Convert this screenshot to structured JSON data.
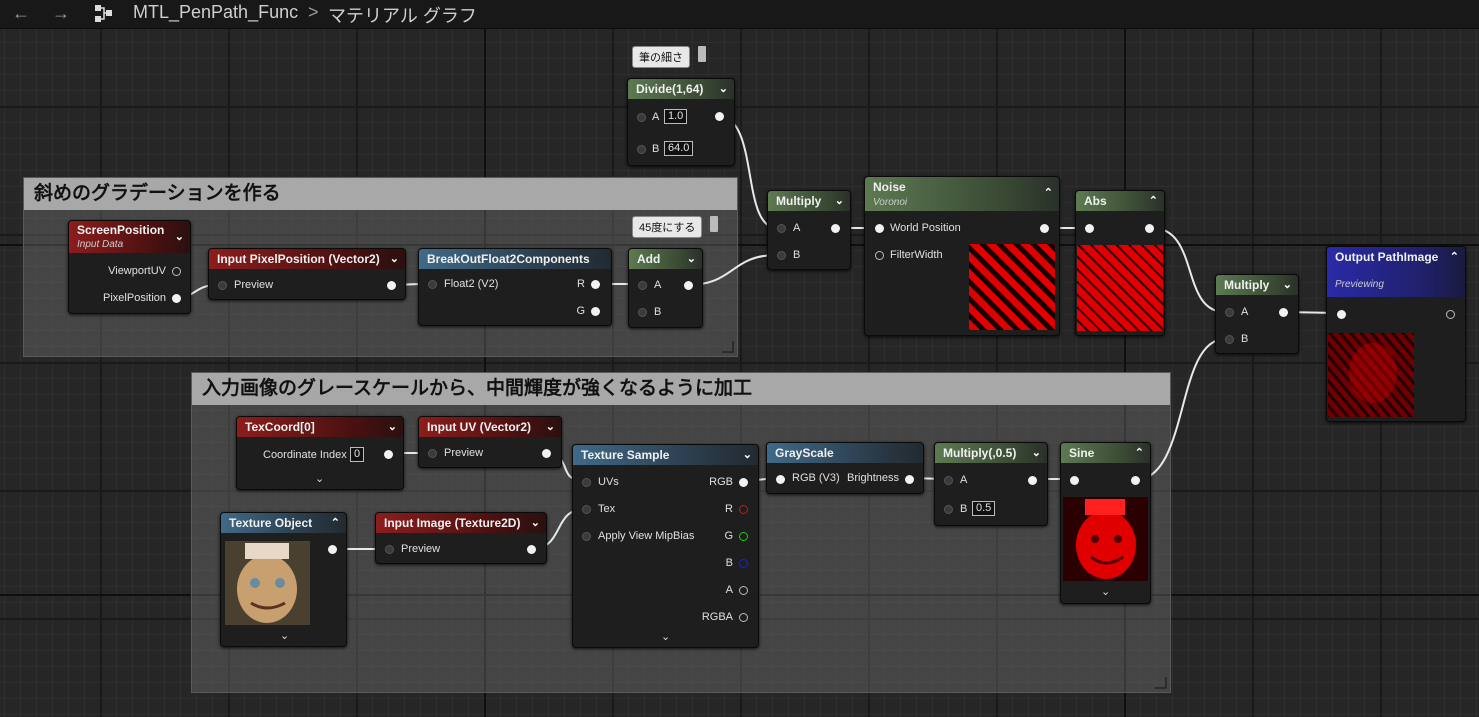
{
  "breadcrumb": {
    "back_icon": "arrow-left-icon",
    "forward_icon": "arrow-right-icon",
    "graph_icon": "node-graph-icon",
    "asset": "MTL_PenPath_Func",
    "separator": ">",
    "graph": "マテリアル グラフ"
  },
  "comments": {
    "gradient": "斜めのグラデーションを作る",
    "gray": "入力画像のグレースケールから、中間輝度が強くなるように加工"
  },
  "tags": {
    "pen_width": "筆の細さ",
    "rotate45": "45度にする"
  },
  "nodes": {
    "screen_position": {
      "title": "ScreenPosition",
      "subtitle": "Input Data",
      "out1": "ViewportUV",
      "out2": "PixelPosition"
    },
    "input_pixel": {
      "title": "Input PixelPosition (Vector2)",
      "pin": "Preview"
    },
    "breakout": {
      "title": "BreakOutFloat2Components",
      "in": "Float2 (V2)",
      "out_r": "R",
      "out_g": "G"
    },
    "add": {
      "title": "Add",
      "a": "A",
      "b": "B"
    },
    "divide": {
      "title": "Divide(1,64)",
      "a": "A",
      "a_val": "1.0",
      "b": "B",
      "b_val": "64.0"
    },
    "multiply1": {
      "title": "Multiply",
      "a": "A",
      "b": "B"
    },
    "noise": {
      "title": "Noise",
      "subtitle": "Voronoi",
      "pin1": "World Position",
      "pin2": "FilterWidth"
    },
    "abs": {
      "title": "Abs"
    },
    "multiply2": {
      "title": "Multiply",
      "a": "A",
      "b": "B"
    },
    "output": {
      "title": "Output PathImage",
      "subtitle": "Previewing"
    },
    "texcoord": {
      "title": "TexCoord[0]",
      "pin": "Coordinate Index",
      "val": "0"
    },
    "input_uv": {
      "title": "Input UV (Vector2)",
      "pin": "Preview"
    },
    "texture_sample": {
      "title": "Texture Sample",
      "in1": "UVs",
      "in2": "Tex",
      "in3": "Apply View MipBias",
      "out1": "RGB",
      "out2": "R",
      "out3": "G",
      "out4": "B",
      "out5": "A",
      "out6": "RGBA"
    },
    "grayscale": {
      "title": "GrayScale",
      "in": "RGB (V3)",
      "out": "Brightness"
    },
    "multiply05": {
      "title": "Multiply(,0.5)",
      "a": "A",
      "b": "B",
      "b_val": "0.5"
    },
    "sine": {
      "title": "Sine"
    },
    "texture_object": {
      "title": "Texture Object"
    },
    "input_image": {
      "title": "Input Image (Texture2D)",
      "pin": "Preview"
    }
  },
  "icons": {
    "collapse": "chevron-up-icon",
    "expand": "chevron-down-icon"
  },
  "colors": {
    "red_header": "#8c1d1d",
    "green_header": "#5d7a52",
    "blue_header": "#3f6a88",
    "output_header": "#2a2aa8",
    "pin_red": "#e01010",
    "pin_green": "#10d010",
    "pin_blue": "#1a1aff"
  }
}
